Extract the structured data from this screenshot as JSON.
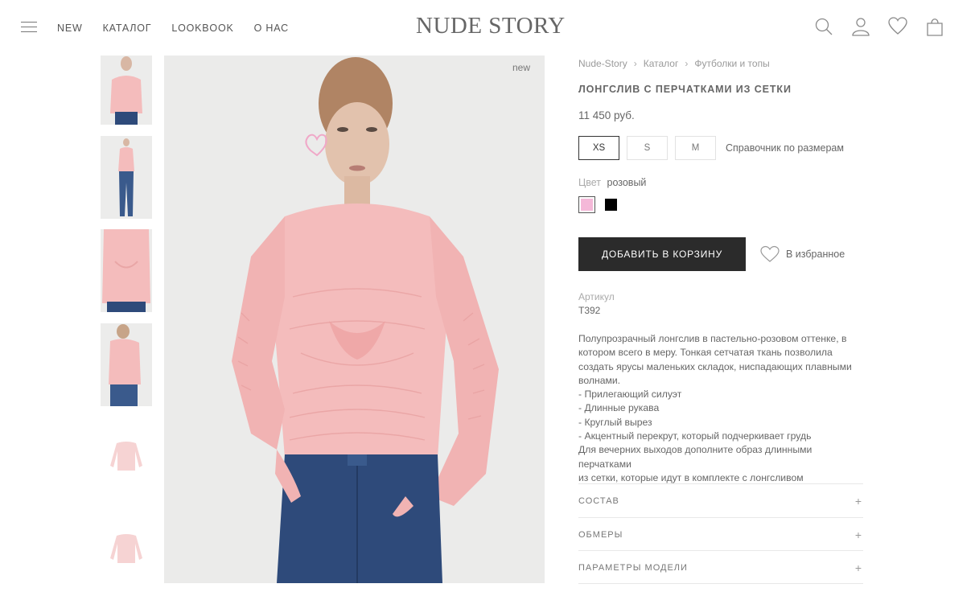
{
  "header": {
    "logo": "NUDE STORY",
    "nav": [
      "NEW",
      "КАТАЛОГ",
      "LOOKBOOK",
      "О НАС"
    ],
    "icons": [
      "search-icon",
      "user-icon",
      "heart-icon",
      "bag-icon"
    ]
  },
  "product": {
    "badge": "new",
    "breadcrumbs": [
      "Nude-Story",
      "Каталог",
      "Футболки и топы"
    ],
    "title": "ЛОНГСЛИВ С ПЕРЧАТКАМИ ИЗ СЕТКИ",
    "price": "11 450 руб.",
    "sizes": [
      "XS",
      "S",
      "M"
    ],
    "selected_size": "XS",
    "size_guide": "Справочник по размерам",
    "color_label": "Цвет",
    "color_value": "розовый",
    "swatches": [
      {
        "name": "розовый",
        "color": "#f4b8d8"
      },
      {
        "name": "черный",
        "color": "#000000"
      }
    ],
    "add_to_cart": "ДОБАВИТЬ В КОРЗИНУ",
    "favorite": "В избранное",
    "sku_label": "Артикул",
    "sku": "T392",
    "description": [
      "Полупрозрачный лонгслив в пастельно-розовом оттенке, в",
      "котором всего в меру. Тонкая сетчатая ткань позволила",
      "создать ярусы маленьких складок, ниспадающих плавными",
      "волнами.",
      "- Прилегающий силуэт",
      "- Длинные рукава",
      "- Круглый вырез",
      "- Акцентный перекрут, который подчеркивает грудь",
      "Для вечерних выходов дополните образ длинными перчатками",
      "из сетки, которые идут в комплекте с лонгсливом"
    ],
    "accordion": [
      {
        "title": "СОСТАВ",
        "icon": "+"
      },
      {
        "title": "ОБМЕРЫ",
        "icon": "+"
      },
      {
        "title": "ПАРАМЕТРЫ МОДЕЛИ",
        "icon": "+"
      }
    ]
  },
  "colors": {
    "button_bg": "#2b2b2b",
    "shirt_pink": "#f4bcbc",
    "jeans_blue": "#2e4a7a"
  }
}
